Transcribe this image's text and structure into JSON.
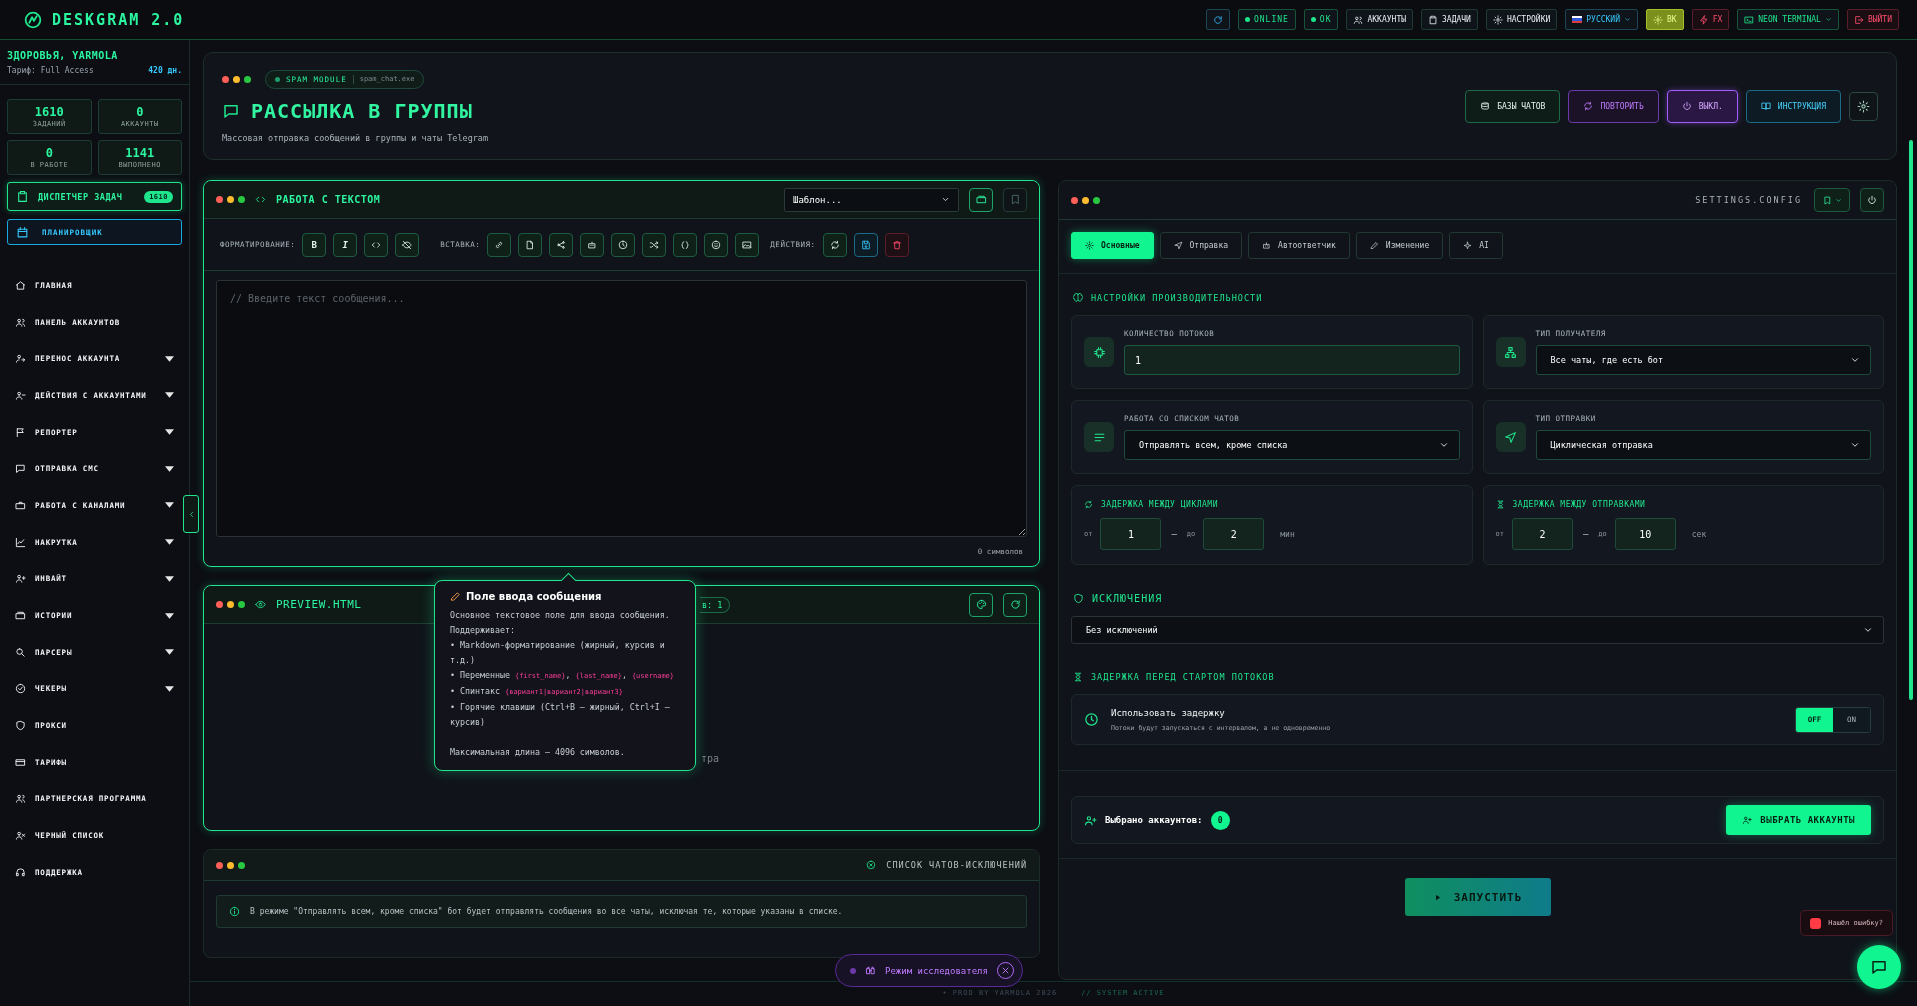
{
  "app": {
    "title": "DESKGRAM 2.0"
  },
  "topbar": [
    {
      "kind": "status",
      "label": "ONLINE"
    },
    {
      "kind": "status",
      "label": "OK"
    },
    {
      "kind": "nav",
      "label": "АККАУНТЫ"
    },
    {
      "kind": "nav",
      "label": "ЗАДАЧИ"
    },
    {
      "kind": "nav",
      "label": "НАСТРОЙКИ"
    },
    {
      "kind": "lang",
      "label": "РУССКИЙ"
    },
    {
      "kind": "profile",
      "label": "ВК"
    },
    {
      "kind": "danger",
      "label": "FX"
    },
    {
      "kind": "theme",
      "label": "NEON TERMINAL"
    },
    {
      "kind": "logout",
      "label": "ВЫЙТИ"
    }
  ],
  "sidebar": {
    "user": "ЗДОРОВЬЯ, YARMOLA",
    "plan": "Тариф: Full Access",
    "days": "420 дн.",
    "stats": [
      {
        "value": "1610",
        "label": "ЗАДАНИЙ"
      },
      {
        "value": "0",
        "label": "АККАУНТЫ"
      },
      {
        "value": "0",
        "label": "В РАБОТЕ"
      },
      {
        "value": "1141",
        "label": "ВЫПОЛНЕНО"
      }
    ],
    "dispatcher": {
      "label": "ДИСПЕТЧЕР ЗАДАЧ",
      "badge": "1610"
    },
    "planner": {
      "label": "ПЛАНИРОВЩИК"
    },
    "items": [
      {
        "label": "ГЛАВНАЯ",
        "expandable": false
      },
      {
        "label": "ПАНЕЛЬ АККАУНТОВ",
        "expandable": false
      },
      {
        "label": "ПЕРЕНОС АККАУНТА",
        "expandable": true
      },
      {
        "label": "ДЕЙСТВИЯ С АККАУНТАМИ",
        "expandable": true
      },
      {
        "label": "РЕПОРТЕР",
        "expandable": true
      },
      {
        "label": "ОТПРАВКА СМС",
        "expandable": true
      },
      {
        "label": "РАБОТА С КАНАЛАМИ",
        "expandable": true
      },
      {
        "label": "НАКРУТКА",
        "expandable": true
      },
      {
        "label": "ИНВАЙТ",
        "expandable": true
      },
      {
        "label": "ИСТОРИИ",
        "expandable": true
      },
      {
        "label": "ПАРСЕРЫ",
        "expandable": true
      },
      {
        "label": "ЧЕКЕРЫ",
        "expandable": true
      },
      {
        "label": "ПРОКСИ",
        "expandable": false
      },
      {
        "label": "ТАРИФЫ",
        "expandable": false
      },
      {
        "label": "ПАРТНЕРСКАЯ ПРОГРАММА",
        "expandable": false
      },
      {
        "label": "ЧЕРНЫЙ СПИСОК",
        "expandable": false
      },
      {
        "label": "ПОДДЕРЖКА",
        "expandable": false
      }
    ]
  },
  "header": {
    "module": "SPAM MODULE",
    "file": "spam_chat.exe",
    "title": "РАССЫЛКА В ГРУППЫ",
    "subtitle": "Массовая отправка сообщений в группы и чаты Telegram",
    "buttons": [
      {
        "kind": "green",
        "label": "БАЗЫ ЧАТОВ"
      },
      {
        "kind": "purple",
        "label": "ПОВТОРИТЬ"
      },
      {
        "kind": "active",
        "label": "ВЫКЛ."
      },
      {
        "kind": "cyan",
        "label": "ИНСТРУКЦИЯ"
      }
    ]
  },
  "text_panel": {
    "title": "РАБОТА С ТЕКСТОМ",
    "template": "Шаблон...",
    "format_label": "ФОРМАТИРОВАНИЕ:",
    "format_buttons": [
      "B",
      "I"
    ],
    "insert_label": "ВСТАВКА:",
    "actions_label": "ДЕЙСТВИЯ:",
    "placeholder": "// Введите текст сообщения...",
    "counter": "0 символов"
  },
  "preview": {
    "title": "PREVIEW.HTML",
    "variants": "в: 1",
    "hint": "тра"
  },
  "tooltip": {
    "title": "Поле ввода сообщения",
    "intro": "Основное текстовое поле для ввода сообщения. Поддерживает:",
    "bullets": [
      [
        {
          "text": "• Markdown-форматирование (жирный, курсив и т.д.)",
          "code": false
        }
      ],
      [
        {
          "text": "• Переменные ",
          "code": false
        },
        {
          "text": "{first_name}",
          "code": true
        },
        {
          "text": ", ",
          "code": false
        },
        {
          "text": "{last_name}",
          "code": true
        },
        {
          "text": ", ",
          "code": false
        },
        {
          "text": "{username}",
          "code": true
        }
      ],
      [
        {
          "text": "• Спинтакс ",
          "code": false
        },
        {
          "text": "{вариант1|вариант2|вариант3}",
          "code": true
        }
      ],
      [
        {
          "text": "• Горячие клавиши (Ctrl+B — жирный, Ctrl+I — курсив)",
          "code": false
        }
      ]
    ],
    "footer": "Максимальная длина — 4096 символов."
  },
  "exclusions_panel": {
    "title": "СПИСОК ЧАТОВ-ИСКЛЮЧЕНИЙ",
    "info": "В режиме \"Отправлять всем, кроме списка\" бот будет отправлять сообщения во все чаты, исключая те, которые указаны в списке."
  },
  "settings": {
    "title": "SETTINGS.CONFIG",
    "tabs": [
      {
        "label": "Основные",
        "selected": true
      },
      {
        "label": "Отправка",
        "selected": false
      },
      {
        "label": "Автоответчик",
        "selected": false
      },
      {
        "label": "Изменение",
        "selected": false
      },
      {
        "label": "AI",
        "selected": false
      }
    ],
    "performance_title": "НАСТРОЙКИ ПРОИЗВОДИТЕЛЬНОСТИ",
    "fields": [
      {
        "kind": "input",
        "label": "КОЛИЧЕСТВО ПОТОКОВ",
        "value": "1"
      },
      {
        "kind": "select",
        "label": "ТИП ПОЛУЧАТЕЛЯ",
        "value": "Все чаты, где есть бот"
      },
      {
        "kind": "select",
        "label": "РАБОТА СО СПИСКОМ ЧАТОВ",
        "value": "Отправлять всем, кроме списка"
      },
      {
        "kind": "select",
        "label": "ТИП ОТПРАВКИ",
        "value": "Циклическая отправка"
      }
    ],
    "delays": [
      {
        "title": "ЗАДЕРЖКА МЕЖДУ ЦИКЛАМИ",
        "from_label": "от",
        "from": "1",
        "dash": "—",
        "to_label": "до",
        "to": "2",
        "unit": "мин"
      },
      {
        "title": "ЗАДЕРЖКА МЕЖДУ ОТПРАВКАМИ",
        "from_label": "от",
        "from": "2",
        "dash": "—",
        "to_label": "до",
        "to": "10",
        "unit": "сек"
      }
    ],
    "exclusions_title": "ИСКЛЮЧЕНИЯ",
    "exclusions_value": "Без исключений",
    "start_delay_title": "ЗАДЕРЖКА ПЕРЕД СТАРТОМ ПОТОКОВ",
    "start_delay": {
      "label": "Использовать задержку",
      "description": "Потоки будут запускаться с интервалом, а не одновременно",
      "options": [
        {
          "label": "OFF",
          "selected": true
        },
        {
          "label": "ON",
          "selected": false
        }
      ]
    },
    "accounts_label": "Выбрано аккаунтов:",
    "accounts_count": "0",
    "select_accounts": "ВЫБРАТЬ АККАУНТЫ",
    "run": "ЗАПУСТИТЬ"
  },
  "explorer": {
    "label": "Режим исследователя"
  },
  "bug_report": "Нашёл ошибку?",
  "footer": {
    "credit": "• PROD BY YARMOLA 2026",
    "status": "// SYSTEM ACTIVE"
  }
}
